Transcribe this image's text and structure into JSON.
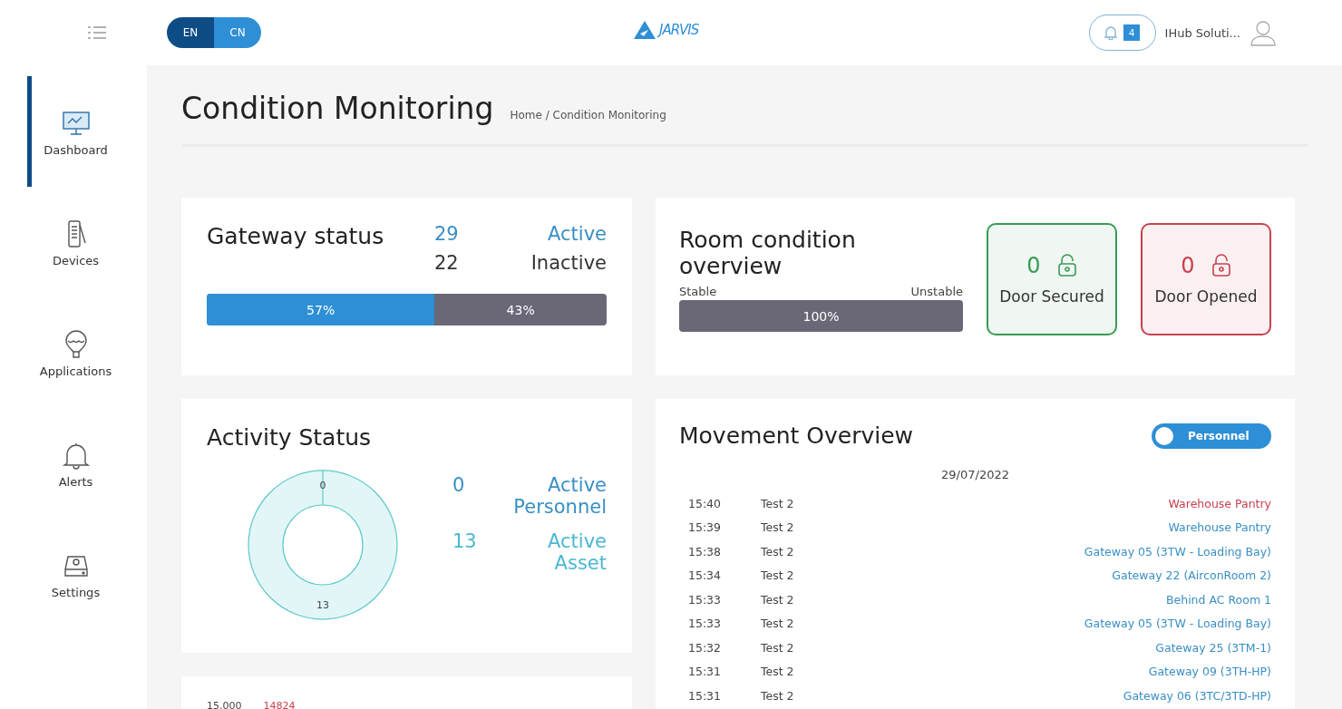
{
  "topbar": {
    "languages": [
      {
        "label": "EN",
        "selected": true
      },
      {
        "label": "CN",
        "selected": false
      }
    ],
    "logo": "JARVIS",
    "notifications": "4",
    "user": "IHub Soluti..."
  },
  "sidebar": {
    "items": [
      {
        "label": "Dashboard",
        "selected": true
      },
      {
        "label": "Devices",
        "selected": false
      },
      {
        "label": "Applications",
        "selected": false
      },
      {
        "label": "Alerts",
        "selected": false
      },
      {
        "label": "Settings",
        "selected": false
      }
    ]
  },
  "page": {
    "title": "Condition Monitoring",
    "breadcrumb": "Home / Condition Monitoring"
  },
  "gateway": {
    "title": "Gateway status",
    "stats": [
      {
        "count": "29",
        "label": "Active",
        "kind": "active"
      },
      {
        "count": "22",
        "label": "Inactive",
        "kind": "inactive"
      }
    ],
    "active": {
      "level": 0.57,
      "reading": "57%"
    },
    "inactive": {
      "reading": "43%"
    }
  },
  "room": {
    "title": "Room condition overview",
    "left_label": "Stable",
    "right_label": "Unstable",
    "unstable": {
      "level": 1.0,
      "reading": "100%"
    },
    "doors": [
      {
        "count": "0",
        "label": "Door Secured",
        "color": "#3a9a55"
      },
      {
        "count": "0",
        "label": "Door Opened",
        "color": "#c8414f"
      }
    ]
  },
  "activity": {
    "title": "Activity Status",
    "stats": [
      {
        "count": "0",
        "label": "Active Personnel"
      },
      {
        "count": "13",
        "label": "Active Asset"
      }
    ],
    "donut_labels": [
      "0",
      "13"
    ]
  },
  "bottom_card": {
    "axis_label": "15,000",
    "value_label": "14824"
  },
  "movement": {
    "title": "Movement Overview",
    "toggle": {
      "label": "Personnel",
      "on": true
    },
    "date": "29/07/2022",
    "rows": [
      {
        "time": "15:40",
        "name": "Test 2",
        "location": "Warehouse Pantry",
        "color": "#c8414f"
      },
      {
        "time": "15:39",
        "name": "Test 2",
        "location": "Warehouse Pantry",
        "color": "#3a8fc4"
      },
      {
        "time": "15:38",
        "name": "Test 2",
        "location": "Gateway 05 (3TW - Loading Bay)",
        "color": "#3a8fc4"
      },
      {
        "time": "15:34",
        "name": "Test 2",
        "location": "Gateway 22 (AirconRoom 2)",
        "color": "#3a8fc4"
      },
      {
        "time": "15:33",
        "name": "Test 2",
        "location": "Behind AC Room 1",
        "color": "#3a8fc4"
      },
      {
        "time": "15:33",
        "name": "Test 2",
        "location": "Gateway 05 (3TW - Loading Bay)",
        "color": "#3a8fc4"
      },
      {
        "time": "15:32",
        "name": "Test 2",
        "location": "Gateway 25 (3TM-1)",
        "color": "#3a8fc4"
      },
      {
        "time": "15:31",
        "name": "Test 2",
        "location": "Gateway 09 (3TH-HP)",
        "color": "#3a8fc4"
      },
      {
        "time": "15:31",
        "name": "Test 2",
        "location": "Gateway 06 (3TC/3TD-HP)",
        "color": "#3a8fc4"
      }
    ]
  }
}
